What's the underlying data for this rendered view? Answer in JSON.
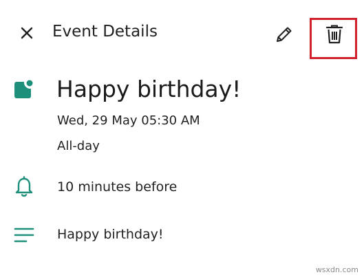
{
  "header": {
    "title": "Event Details",
    "close_icon": "close-icon",
    "edit_icon": "pencil-icon",
    "delete_icon": "trash-icon"
  },
  "event": {
    "color": "#1d8f7a",
    "title": "Happy birthday!",
    "datetime": "Wed, 29 May 05:30 AM",
    "all_day": "All-day",
    "reminder": "10 minutes before",
    "notes": "Happy birthday!"
  },
  "highlight_color": "#d0202a",
  "watermark": "wsxdn.com"
}
